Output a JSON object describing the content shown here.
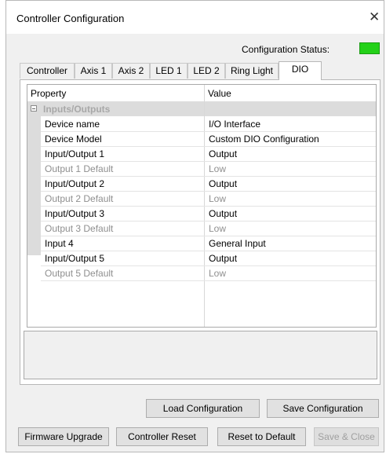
{
  "window": {
    "title": "Controller Configuration",
    "close_glyph": "✕"
  },
  "status": {
    "label": "Configuration Status:",
    "indicator_color": "#24d119"
  },
  "tabs": [
    {
      "label": "Controller"
    },
    {
      "label": "Axis 1"
    },
    {
      "label": "Axis 2"
    },
    {
      "label": "LED 1"
    },
    {
      "label": "LED 2"
    },
    {
      "label": "Ring Light"
    },
    {
      "label": "DIO",
      "active": true
    }
  ],
  "grid": {
    "header_property": "Property",
    "header_value": "Value",
    "category": "Inputs/Outputs",
    "rows": [
      {
        "property": "Device name",
        "value": "I/O Interface",
        "dim": false
      },
      {
        "property": "Device Model",
        "value": "Custom DIO Configuration",
        "dim": false
      },
      {
        "property": "Input/Output 1",
        "value": "Output",
        "dim": false
      },
      {
        "property": "Output 1 Default",
        "value": "Low",
        "dim": true
      },
      {
        "property": "Input/Output 2",
        "value": "Output",
        "dim": false
      },
      {
        "property": "Output 2 Default",
        "value": "Low",
        "dim": true
      },
      {
        "property": "Input/Output 3",
        "value": "Output",
        "dim": false
      },
      {
        "property": "Output 3 Default",
        "value": "Low",
        "dim": true
      },
      {
        "property": "Input 4",
        "value": "General Input",
        "dim": false
      },
      {
        "property": "Input/Output 5",
        "value": "Output",
        "dim": false
      },
      {
        "property": "Output 5 Default",
        "value": "Low",
        "dim": true
      }
    ]
  },
  "buttons": {
    "load_config": "Load Configuration",
    "save_config": "Save Configuration",
    "firmware_upgrade": "Firmware Upgrade",
    "controller_reset": "Controller Reset",
    "reset_default": "Reset to Default",
    "save_close": "Save & Close"
  }
}
